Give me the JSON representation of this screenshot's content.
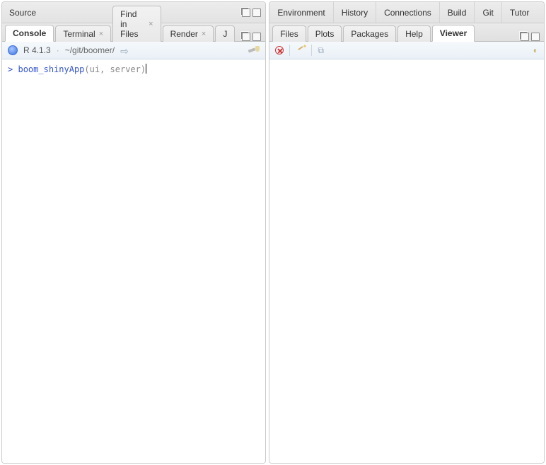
{
  "left": {
    "source_title": "Source",
    "tabs": {
      "console": "Console",
      "terminal": "Terminal",
      "find": "Find in Files",
      "render": "Render",
      "jobs": "J"
    },
    "r_version": "R 4.1.3",
    "dot": "·",
    "working_dir": "~/git/boomer/",
    "console": {
      "prompt": ">",
      "func": "boom_shinyApp",
      "open": "(",
      "args": "ui, server",
      "close": ")"
    }
  },
  "right": {
    "top_tabs": [
      "Environment",
      "History",
      "Connections",
      "Build",
      "Git",
      "Tutor"
    ],
    "lower_tabs": {
      "files": "Files",
      "plots": "Plots",
      "packages": "Packages",
      "help": "Help",
      "viewer": "Viewer"
    }
  }
}
